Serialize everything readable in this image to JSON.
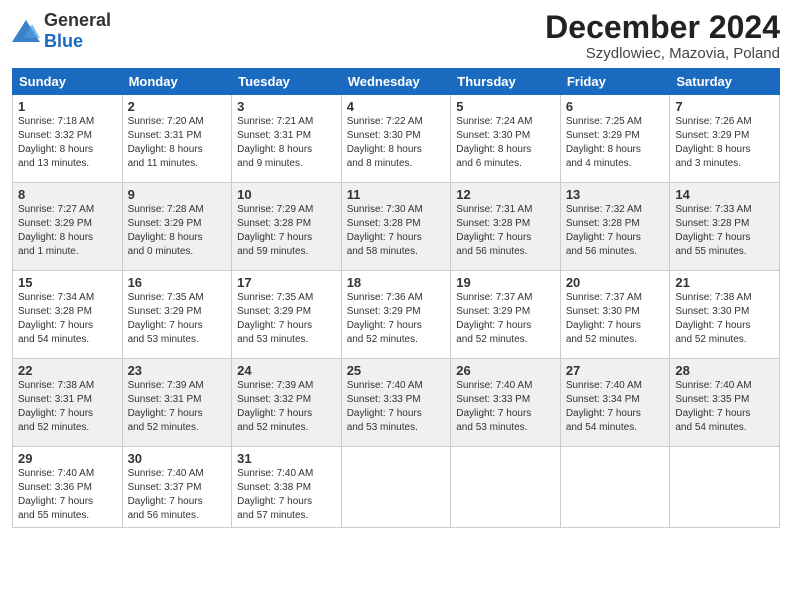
{
  "header": {
    "logo_general": "General",
    "logo_blue": "Blue",
    "month_title": "December 2024",
    "location": "Szydlowiec, Mazovia, Poland"
  },
  "days_of_week": [
    "Sunday",
    "Monday",
    "Tuesday",
    "Wednesday",
    "Thursday",
    "Friday",
    "Saturday"
  ],
  "weeks": [
    [
      {
        "day": "1",
        "info": "Sunrise: 7:18 AM\nSunset: 3:32 PM\nDaylight: 8 hours\nand 13 minutes."
      },
      {
        "day": "2",
        "info": "Sunrise: 7:20 AM\nSunset: 3:31 PM\nDaylight: 8 hours\nand 11 minutes."
      },
      {
        "day": "3",
        "info": "Sunrise: 7:21 AM\nSunset: 3:31 PM\nDaylight: 8 hours\nand 9 minutes."
      },
      {
        "day": "4",
        "info": "Sunrise: 7:22 AM\nSunset: 3:30 PM\nDaylight: 8 hours\nand 8 minutes."
      },
      {
        "day": "5",
        "info": "Sunrise: 7:24 AM\nSunset: 3:30 PM\nDaylight: 8 hours\nand 6 minutes."
      },
      {
        "day": "6",
        "info": "Sunrise: 7:25 AM\nSunset: 3:29 PM\nDaylight: 8 hours\nand 4 minutes."
      },
      {
        "day": "7",
        "info": "Sunrise: 7:26 AM\nSunset: 3:29 PM\nDaylight: 8 hours\nand 3 minutes."
      }
    ],
    [
      {
        "day": "8",
        "info": "Sunrise: 7:27 AM\nSunset: 3:29 PM\nDaylight: 8 hours\nand 1 minute."
      },
      {
        "day": "9",
        "info": "Sunrise: 7:28 AM\nSunset: 3:29 PM\nDaylight: 8 hours\nand 0 minutes."
      },
      {
        "day": "10",
        "info": "Sunrise: 7:29 AM\nSunset: 3:28 PM\nDaylight: 7 hours\nand 59 minutes."
      },
      {
        "day": "11",
        "info": "Sunrise: 7:30 AM\nSunset: 3:28 PM\nDaylight: 7 hours\nand 58 minutes."
      },
      {
        "day": "12",
        "info": "Sunrise: 7:31 AM\nSunset: 3:28 PM\nDaylight: 7 hours\nand 56 minutes."
      },
      {
        "day": "13",
        "info": "Sunrise: 7:32 AM\nSunset: 3:28 PM\nDaylight: 7 hours\nand 56 minutes."
      },
      {
        "day": "14",
        "info": "Sunrise: 7:33 AM\nSunset: 3:28 PM\nDaylight: 7 hours\nand 55 minutes."
      }
    ],
    [
      {
        "day": "15",
        "info": "Sunrise: 7:34 AM\nSunset: 3:28 PM\nDaylight: 7 hours\nand 54 minutes."
      },
      {
        "day": "16",
        "info": "Sunrise: 7:35 AM\nSunset: 3:29 PM\nDaylight: 7 hours\nand 53 minutes."
      },
      {
        "day": "17",
        "info": "Sunrise: 7:35 AM\nSunset: 3:29 PM\nDaylight: 7 hours\nand 53 minutes."
      },
      {
        "day": "18",
        "info": "Sunrise: 7:36 AM\nSunset: 3:29 PM\nDaylight: 7 hours\nand 52 minutes."
      },
      {
        "day": "19",
        "info": "Sunrise: 7:37 AM\nSunset: 3:29 PM\nDaylight: 7 hours\nand 52 minutes."
      },
      {
        "day": "20",
        "info": "Sunrise: 7:37 AM\nSunset: 3:30 PM\nDaylight: 7 hours\nand 52 minutes."
      },
      {
        "day": "21",
        "info": "Sunrise: 7:38 AM\nSunset: 3:30 PM\nDaylight: 7 hours\nand 52 minutes."
      }
    ],
    [
      {
        "day": "22",
        "info": "Sunrise: 7:38 AM\nSunset: 3:31 PM\nDaylight: 7 hours\nand 52 minutes."
      },
      {
        "day": "23",
        "info": "Sunrise: 7:39 AM\nSunset: 3:31 PM\nDaylight: 7 hours\nand 52 minutes."
      },
      {
        "day": "24",
        "info": "Sunrise: 7:39 AM\nSunset: 3:32 PM\nDaylight: 7 hours\nand 52 minutes."
      },
      {
        "day": "25",
        "info": "Sunrise: 7:40 AM\nSunset: 3:33 PM\nDaylight: 7 hours\nand 53 minutes."
      },
      {
        "day": "26",
        "info": "Sunrise: 7:40 AM\nSunset: 3:33 PM\nDaylight: 7 hours\nand 53 minutes."
      },
      {
        "day": "27",
        "info": "Sunrise: 7:40 AM\nSunset: 3:34 PM\nDaylight: 7 hours\nand 54 minutes."
      },
      {
        "day": "28",
        "info": "Sunrise: 7:40 AM\nSunset: 3:35 PM\nDaylight: 7 hours\nand 54 minutes."
      }
    ],
    [
      {
        "day": "29",
        "info": "Sunrise: 7:40 AM\nSunset: 3:36 PM\nDaylight: 7 hours\nand 55 minutes."
      },
      {
        "day": "30",
        "info": "Sunrise: 7:40 AM\nSunset: 3:37 PM\nDaylight: 7 hours\nand 56 minutes."
      },
      {
        "day": "31",
        "info": "Sunrise: 7:40 AM\nSunset: 3:38 PM\nDaylight: 7 hours\nand 57 minutes."
      },
      null,
      null,
      null,
      null
    ]
  ]
}
